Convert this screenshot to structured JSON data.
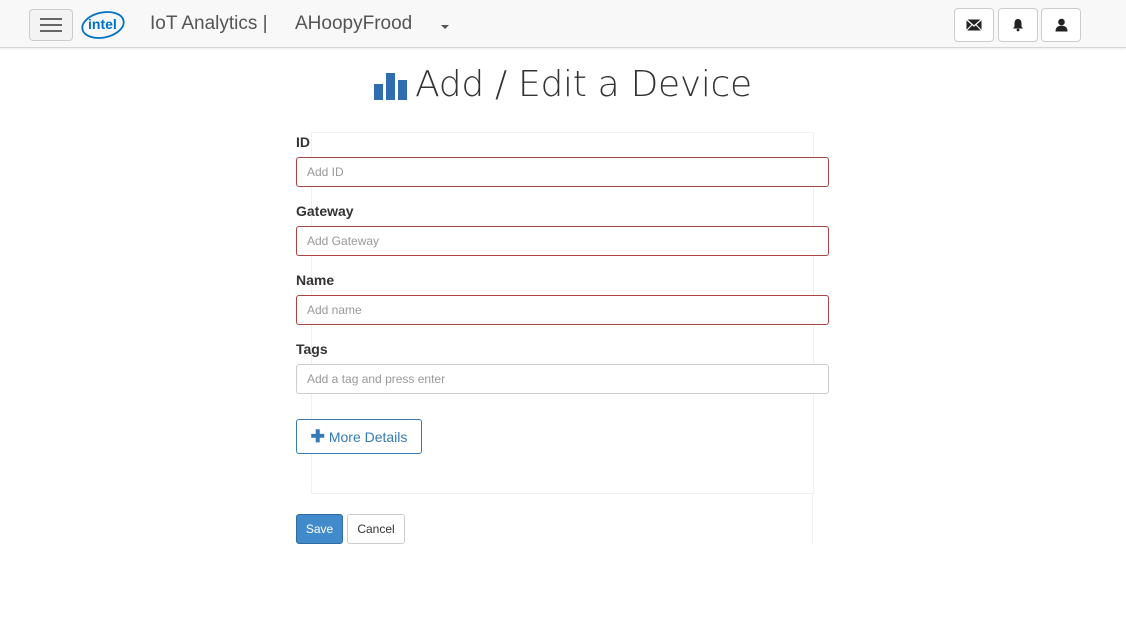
{
  "navbar": {
    "logo_text": "intel",
    "brand": "IoT Analytics |",
    "account_name": "AHoopyFrood",
    "icons": {
      "menu": "hamburger-menu-icon",
      "caret": "caret-down-icon",
      "messages": "envelope-icon",
      "alerts": "bell-icon",
      "profile": "user-icon"
    }
  },
  "page": {
    "title": "Add / Edit a Device",
    "title_icon": "bar-chart-icon"
  },
  "form": {
    "id": {
      "label": "ID",
      "placeholder": "Add ID"
    },
    "gateway": {
      "label": "Gateway",
      "placeholder": "Add Gateway"
    },
    "name": {
      "label": "Name",
      "placeholder": "Add name"
    },
    "tags": {
      "label": "Tags",
      "placeholder": "Add a tag and press enter"
    },
    "more_details": {
      "icon": "plus-icon",
      "label": "More Details"
    },
    "save_label": "Save",
    "cancel_label": "Cancel"
  },
  "colors": {
    "primary": "#428bca",
    "link": "#337ab7",
    "error_border": "#a94442",
    "navbar_bg": "#f8f8f8"
  }
}
